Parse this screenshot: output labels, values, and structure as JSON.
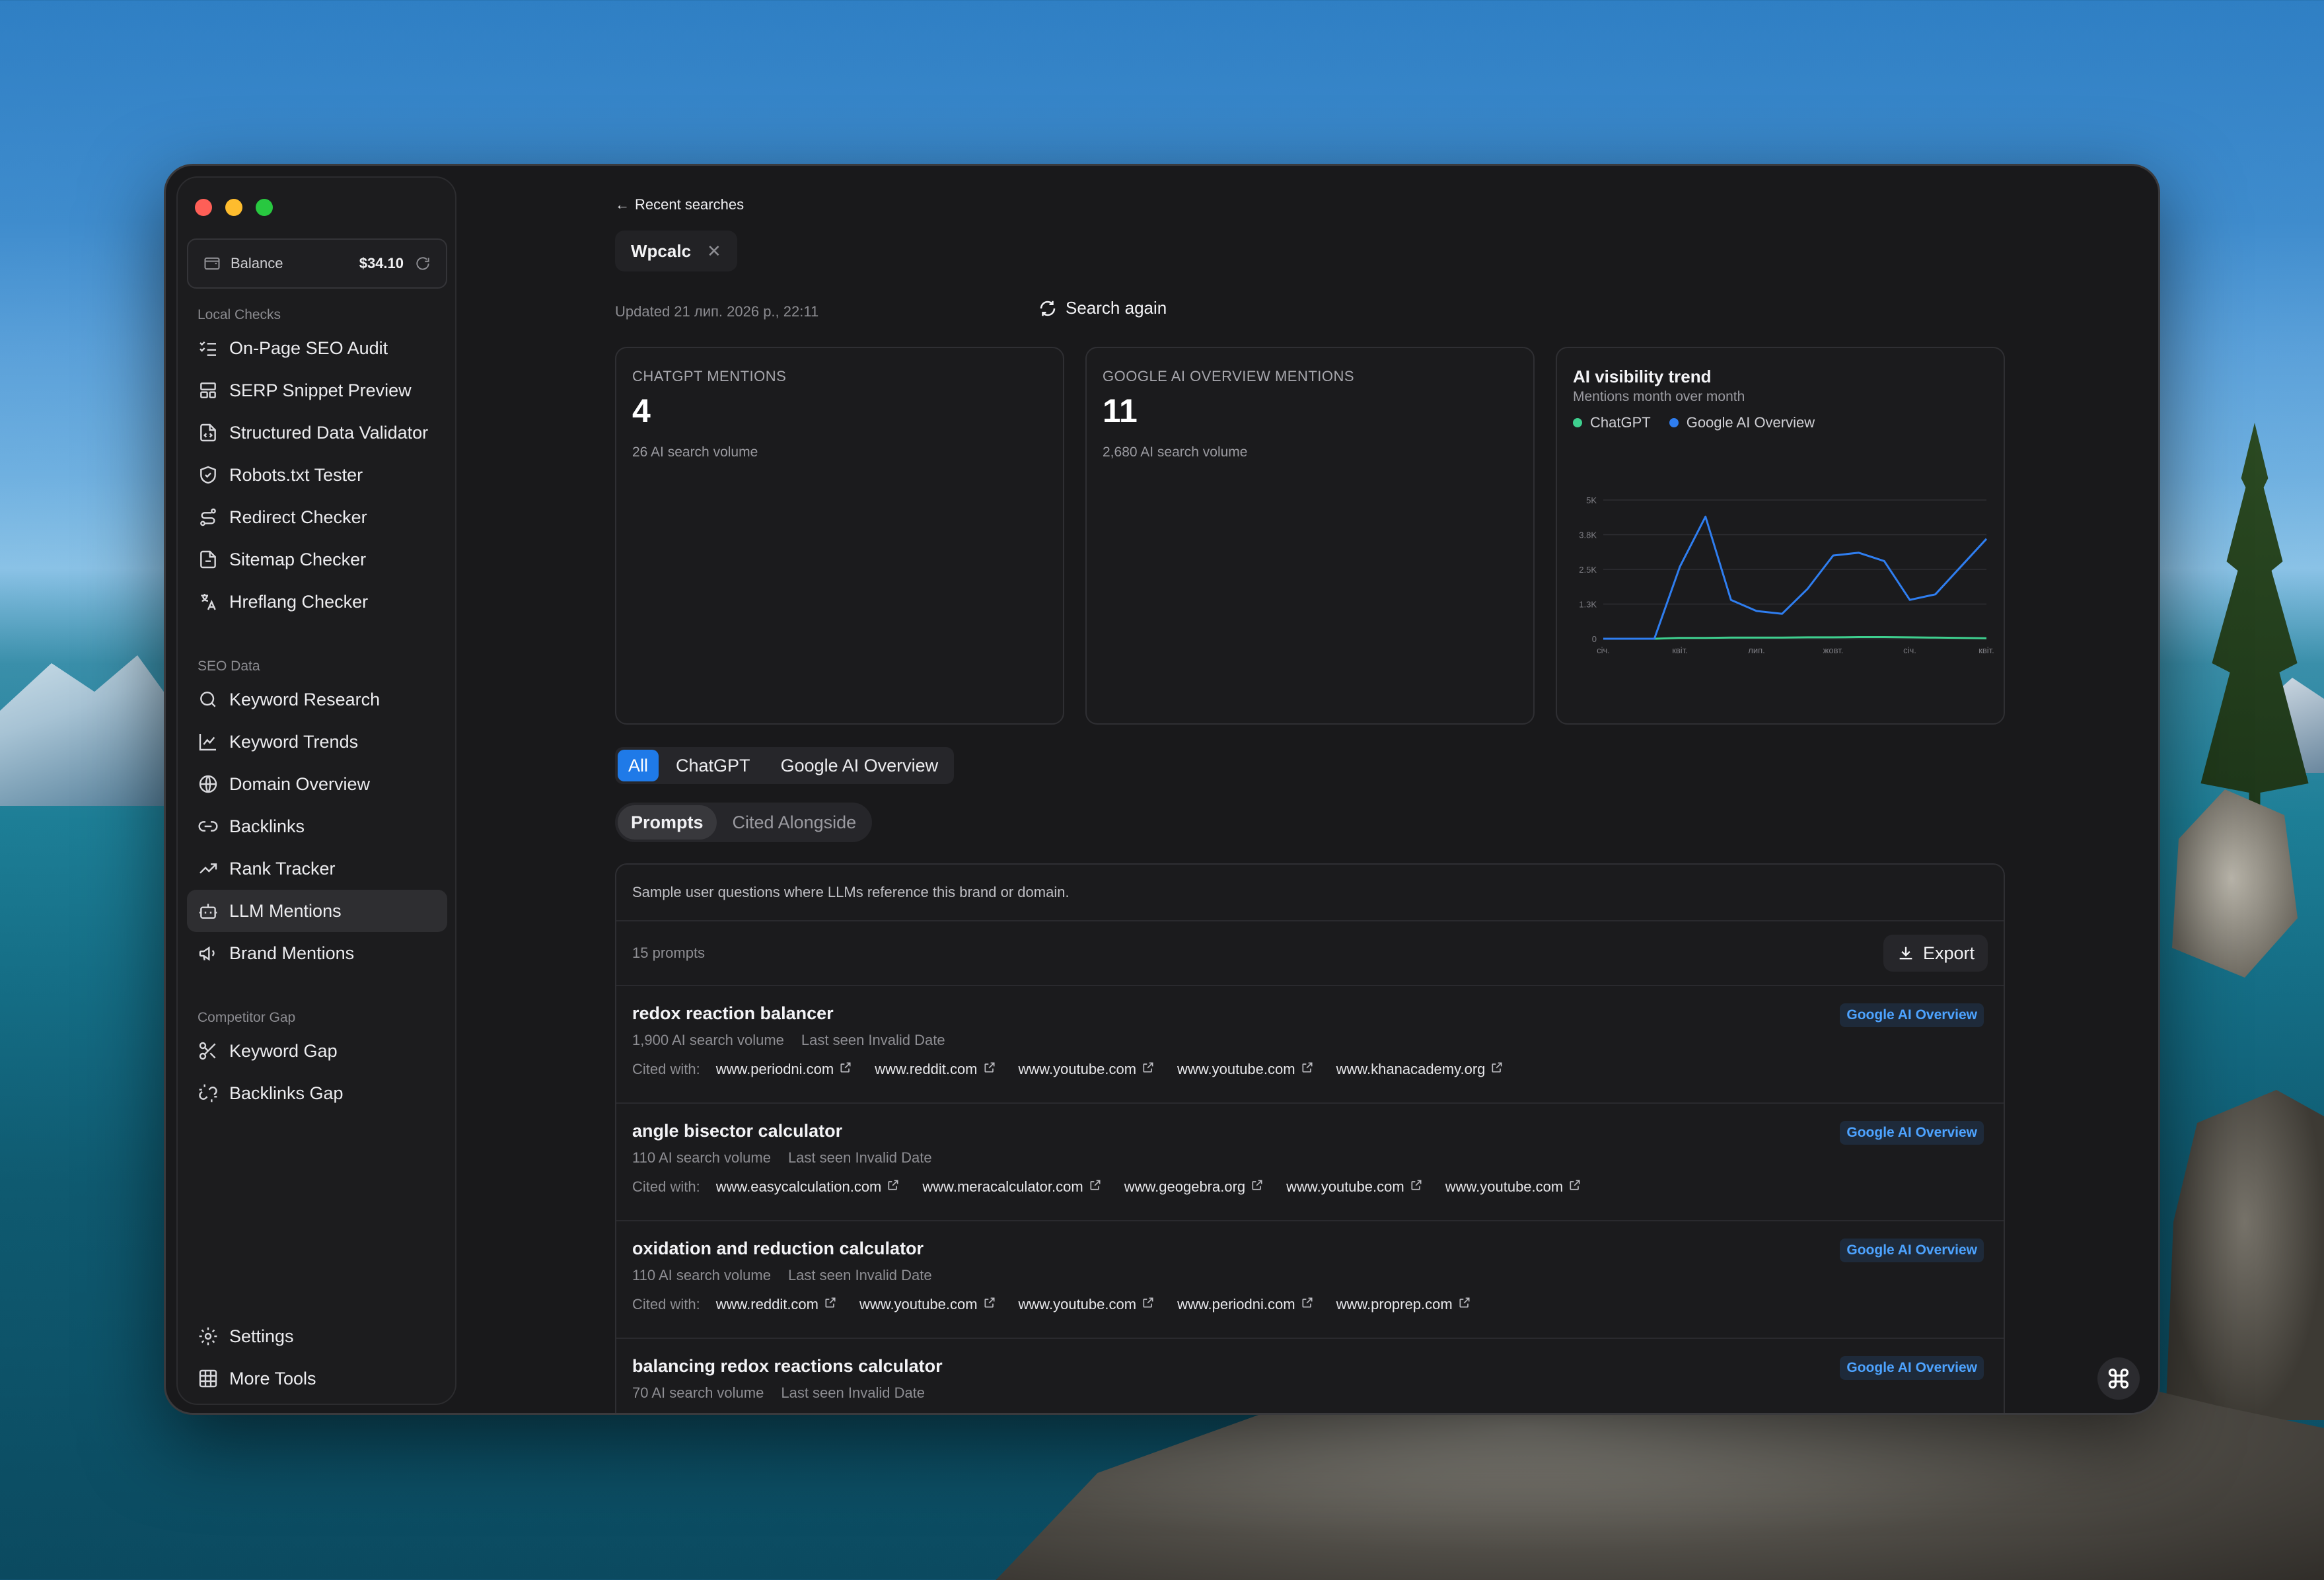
{
  "sidebar": {
    "balance_label": "Balance",
    "balance_value": "$34.10",
    "sections": [
      {
        "title": "Local Checks",
        "items": [
          "On-Page SEO Audit",
          "SERP Snippet Preview",
          "Structured Data Validator",
          "Robots.txt Tester",
          "Redirect Checker",
          "Sitemap Checker",
          "Hreflang Checker"
        ]
      },
      {
        "title": "SEO Data",
        "items": [
          "Keyword Research",
          "Keyword Trends",
          "Domain Overview",
          "Backlinks",
          "Rank Tracker",
          "LLM Mentions",
          "Brand Mentions"
        ]
      },
      {
        "title": "Competitor Gap",
        "items": [
          "Keyword Gap",
          "Backlinks Gap"
        ]
      }
    ],
    "active_item": "LLM Mentions",
    "footer_items": [
      "Settings",
      "More Tools"
    ]
  },
  "header": {
    "back_label": "Recent searches",
    "chip_label": "Wpcalc",
    "updated_text": "Updated 21 лип. 2026 р., 22:11",
    "search_again_label": "Search again"
  },
  "cards": {
    "chatgpt": {
      "caption": "CHATGPT MENTIONS",
      "value": "4",
      "sub": "26 AI search volume"
    },
    "google": {
      "caption": "GOOGLE AI OVERVIEW MENTIONS",
      "value": "11",
      "sub": "2,680 AI search volume"
    },
    "trend": {
      "title": "AI visibility trend",
      "subtitle": "Mentions month over month",
      "legend": [
        {
          "name": "ChatGPT",
          "color": "#3ecf8e"
        },
        {
          "name": "Google AI Overview",
          "color": "#2f7ef0"
        }
      ]
    }
  },
  "chart_data": {
    "type": "line",
    "title": "AI visibility trend",
    "subtitle": "Mentions month over month",
    "y_ticks": [
      "5K",
      "3.8K",
      "2.5K",
      "1.3K",
      "0"
    ],
    "x_ticks": [
      "січ.",
      "квіт.",
      "лип.",
      "жовт.",
      "січ.",
      "квіт."
    ],
    "ylim": [
      0,
      5000
    ],
    "grid": true,
    "legend_position": "top-left",
    "series": [
      {
        "name": "ChatGPT",
        "color": "#3ecf8e",
        "values": [
          0,
          0,
          0,
          30,
          30,
          40,
          40,
          40,
          50,
          50,
          60,
          60,
          50,
          40,
          30,
          20
        ]
      },
      {
        "name": "Google AI Overview",
        "color": "#2f7ef0",
        "values": [
          0,
          0,
          0,
          2600,
          4400,
          1400,
          1000,
          900,
          1800,
          3000,
          3100,
          2800,
          1400,
          1600,
          2600,
          3600
        ]
      }
    ]
  },
  "tabs": {
    "source": [
      "All",
      "ChatGPT",
      "Google AI Overview"
    ],
    "source_active": "All",
    "view": [
      "Prompts",
      "Cited Alongside"
    ],
    "view_active": "Prompts"
  },
  "table": {
    "description": "Sample user questions where LLMs reference this brand or domain.",
    "count_label": "15 prompts",
    "export_label": "Export",
    "cited_label": "Cited with:",
    "rows": [
      {
        "query": "redox reaction balancer",
        "volume": "1,900 AI search volume",
        "last_seen": "Last seen Invalid Date",
        "badge": "Google AI Overview",
        "cited": [
          "www.periodni.com",
          "www.reddit.com",
          "www.youtube.com",
          "www.youtube.com",
          "www.khanacademy.org"
        ]
      },
      {
        "query": "angle bisector calculator",
        "volume": "110 AI search volume",
        "last_seen": "Last seen Invalid Date",
        "badge": "Google AI Overview",
        "cited": [
          "www.easycalculation.com",
          "www.meracalculator.com",
          "www.geogebra.org",
          "www.youtube.com",
          "www.youtube.com"
        ]
      },
      {
        "query": "oxidation and reduction calculator",
        "volume": "110 AI search volume",
        "last_seen": "Last seen Invalid Date",
        "badge": "Google AI Overview",
        "cited": [
          "www.reddit.com",
          "www.youtube.com",
          "www.youtube.com",
          "www.periodni.com",
          "www.proprep.com"
        ]
      },
      {
        "query": "balancing redox reactions calculator",
        "volume": "70 AI search volume",
        "last_seen": "Last seen Invalid Date",
        "badge": "Google AI Overview",
        "cited": []
      }
    ]
  }
}
